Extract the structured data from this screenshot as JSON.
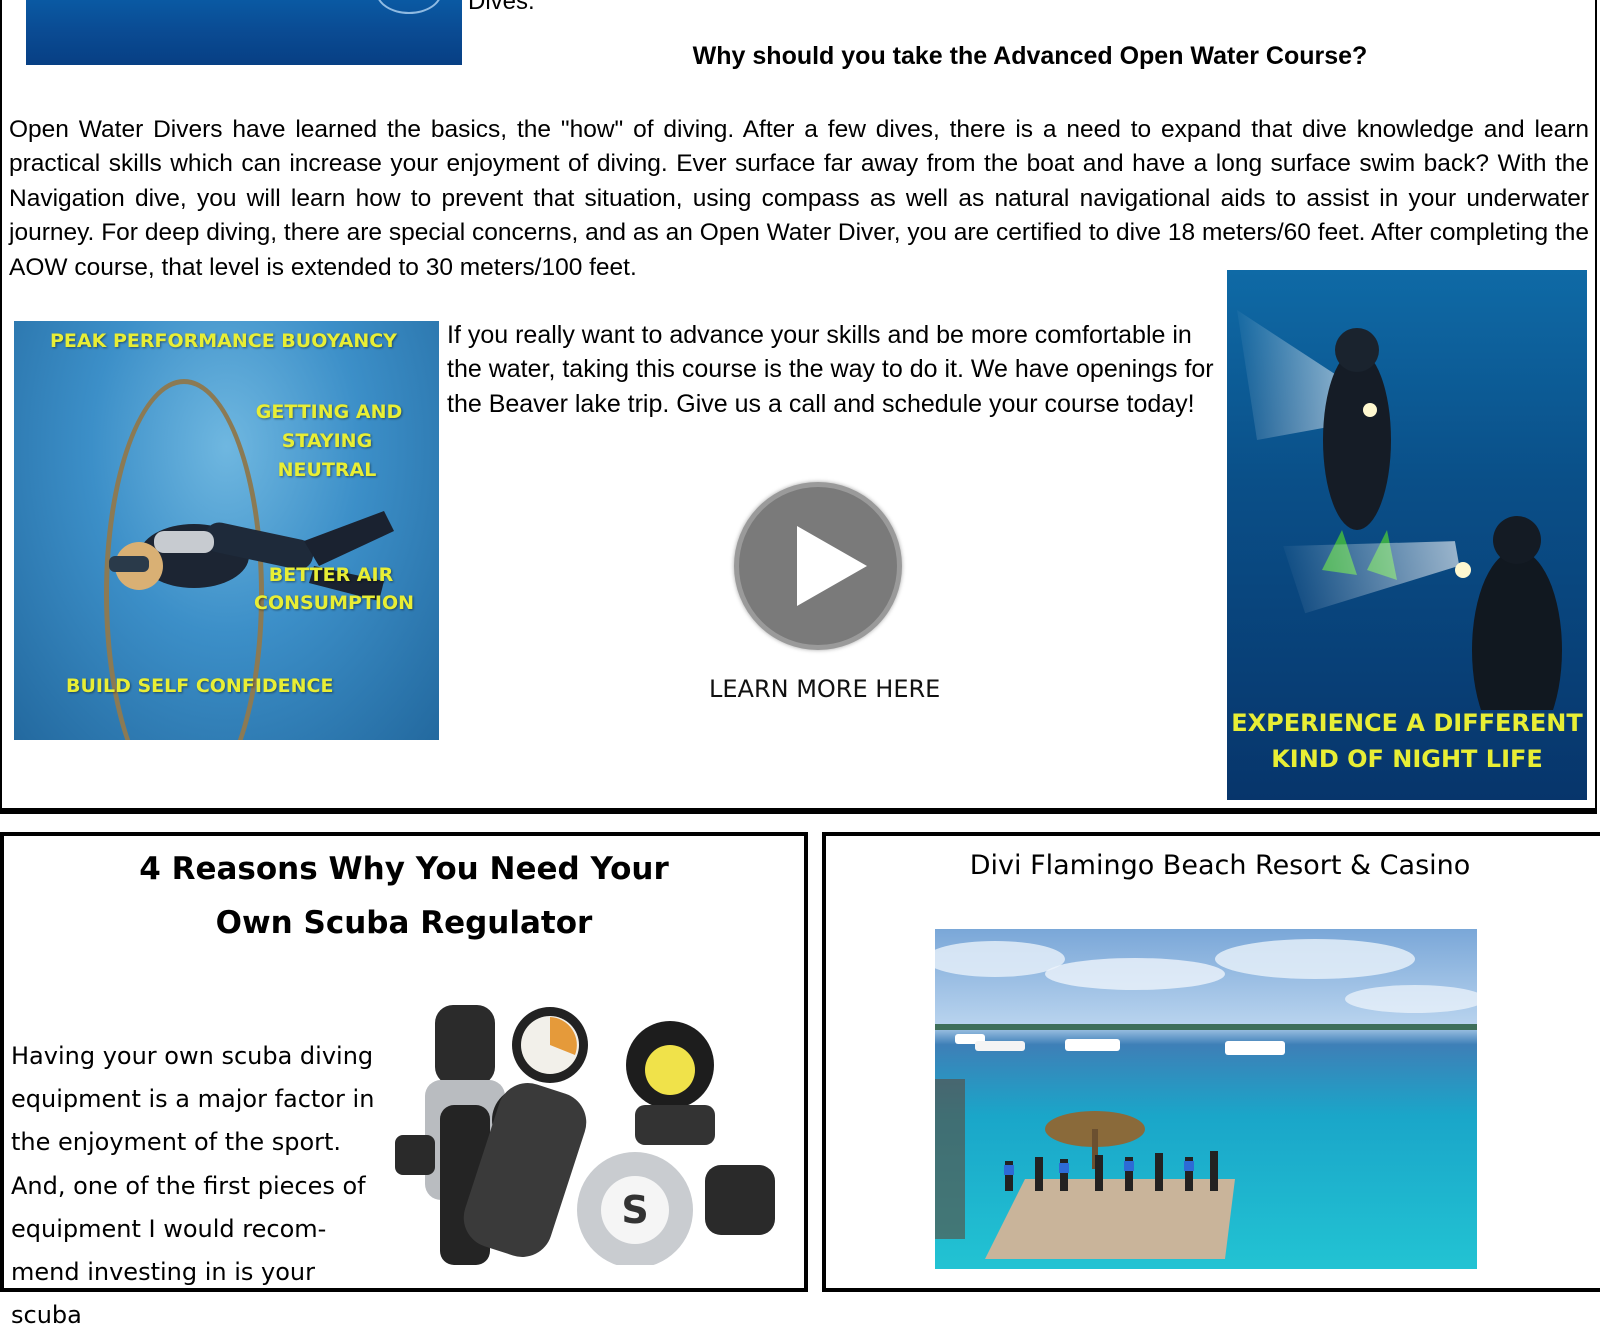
{
  "top": {
    "dives_tail": "Dives.",
    "heading": "Why should you take the Advanced Open Water Course?",
    "paragraph_1": "Open Water Divers have learned the basics, the \"how\" of diving. After a few dives, there is a need to expand that dive knowledge and learn practical skills which can increase your enjoyment of diving. Ever surface far away from the boat and have a long surface swim back? With the Navigation dive, you will learn how to prevent that situation, using compass as well as natural navigational aids to assist in your underwater journey. For deep diving, there are special concerns, and as an Open Water Diver, you are certified to dive 18 meters/60 feet. After completing the AOW course, that level is extended to 30 meters/100 feet.",
    "paragraph_2": "If you really want to advance your skills and be more comfortable in the water, taking this course is the way to do it.  We have openings for the  Beaver lake trip.  Give us a call and schedule your course   today!",
    "learn_more": "LEARN MORE HERE",
    "buoyancy_captions": {
      "peak": "PEAK PERFORMANCE BUOYANCY",
      "neutral_1": "GETTING AND",
      "neutral_2": "STAYING NEUTRAL",
      "air_1": "BETTER AIR",
      "air_2": "CONSUMPTION",
      "confidence": "BUILD SELF CONFIDENCE"
    },
    "night_caption_1": "EXPERIENCE A DIFFERENT",
    "night_caption_2": "KIND OF NIGHT LIFE"
  },
  "regulator": {
    "heading_1": "4 Reasons Why You Need Your",
    "heading_2": "Own Scuba Regulator",
    "paragraph": "Having your own scuba diving equipment is a major factor in the enjoyment of the sport. And, one of the first pieces of equipment I would recom-mend investing in is your scuba"
  },
  "resort": {
    "title": "Divi Flamingo Beach Resort & Casino"
  },
  "colors": {
    "caption_yellow": "#e8ee35",
    "play_button": "#7a7a7a",
    "border": "#000000"
  }
}
